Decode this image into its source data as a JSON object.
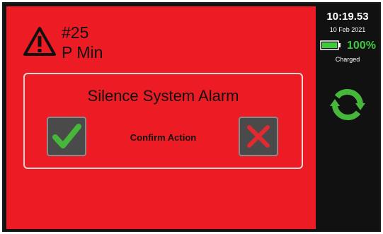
{
  "alarm": {
    "number": "#25",
    "name": "P Min",
    "icon": "warning-triangle-icon"
  },
  "dialog": {
    "title": "Silence System Alarm",
    "confirm_label": "Confirm Action",
    "confirm_icon": "checkmark-icon",
    "cancel_icon": "x-close-icon"
  },
  "status": {
    "time": "10:19.53",
    "date": "10 Feb 2021",
    "battery_percent": "100%",
    "battery_level": 1.0,
    "battery_status": "Charged",
    "refresh_icon": "refresh-icon"
  },
  "colors": {
    "alarm_background": "#ed1c24",
    "side_panel": "#111111",
    "battery_green": "#3ec93e",
    "check_green": "#46b73a",
    "x_red": "#e3282f"
  }
}
